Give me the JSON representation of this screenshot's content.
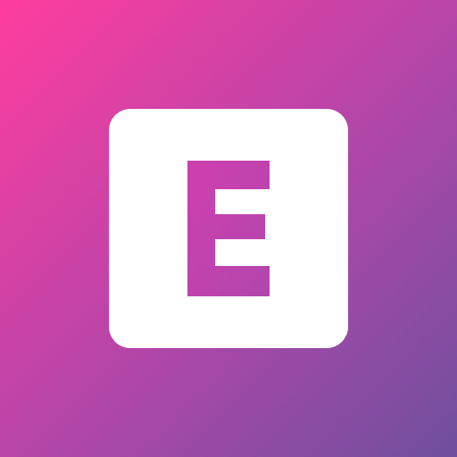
{
  "icon": {
    "letter": "E",
    "symbol": "letter-e-icon",
    "colors": {
      "gradient_start": "#ff3d9e",
      "gradient_mid": "#c044a8",
      "gradient_end": "#6f4f9e",
      "tile": "#ffffff"
    }
  }
}
